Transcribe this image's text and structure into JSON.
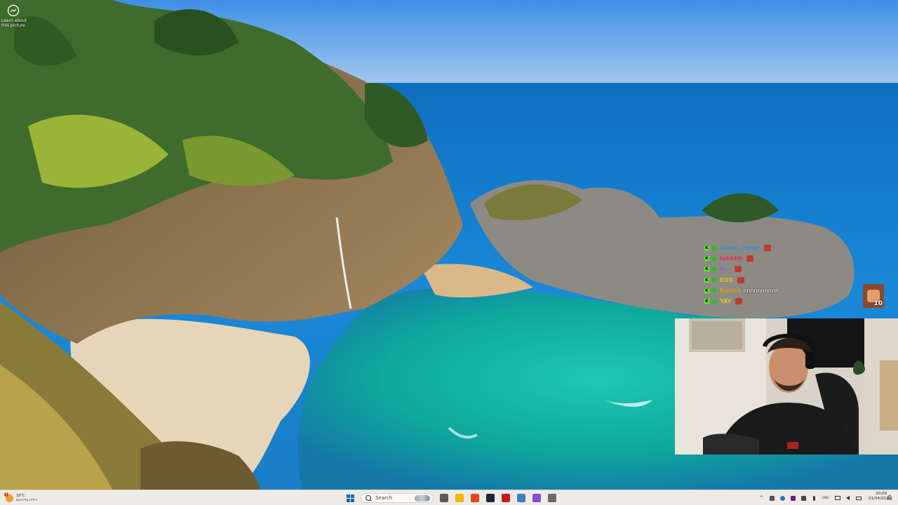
{
  "desktop": {
    "spotlight": {
      "icon": "camera-icon",
      "label": "Learn about\nthis picture"
    }
  },
  "chat": {
    "messages": [
      {
        "user": "Tombi_Dome",
        "message": "",
        "user_color": "#3a8fe0"
      },
      {
        "user": "tuhhhh",
        "message": "",
        "user_color": "#e0304a"
      },
      {
        "user": "R...",
        "message": "",
        "user_color": "#8a5fd8"
      },
      {
        "user": "EOD",
        "message": "",
        "user_color": "#e0c020"
      },
      {
        "user": "Kaiosh",
        "message": "nnnnnnnnnn",
        "user_color": "#e09a20"
      },
      {
        "user": "YAY",
        "message": "",
        "user_color": "#e0c020"
      }
    ],
    "viewer_count": "10"
  },
  "taskbar": {
    "weather": {
      "temp": "18°C",
      "condition": "ירידה בדירוגים",
      "alert_count": "1"
    },
    "search_placeholder": "Search",
    "apps": [
      {
        "name": "task-view-icon",
        "color": "#5b5b5b"
      },
      {
        "name": "file-explorer-icon",
        "color": "#f2b600"
      },
      {
        "name": "brave-browser-icon",
        "color": "#e8451e"
      },
      {
        "name": "steam-icon",
        "color": "#1b2838"
      },
      {
        "name": "app-red-icon",
        "color": "#c21c1c"
      },
      {
        "name": "app-blue-icon",
        "color": "#3d7fc4"
      },
      {
        "name": "messenger-icon",
        "color": "#8a4bd8"
      },
      {
        "name": "settings-icon",
        "color": "#6a6a6a"
      }
    ],
    "tray": {
      "chevron": "^",
      "language": "ENG",
      "time": "20:09",
      "date": "01/04/2026"
    }
  }
}
